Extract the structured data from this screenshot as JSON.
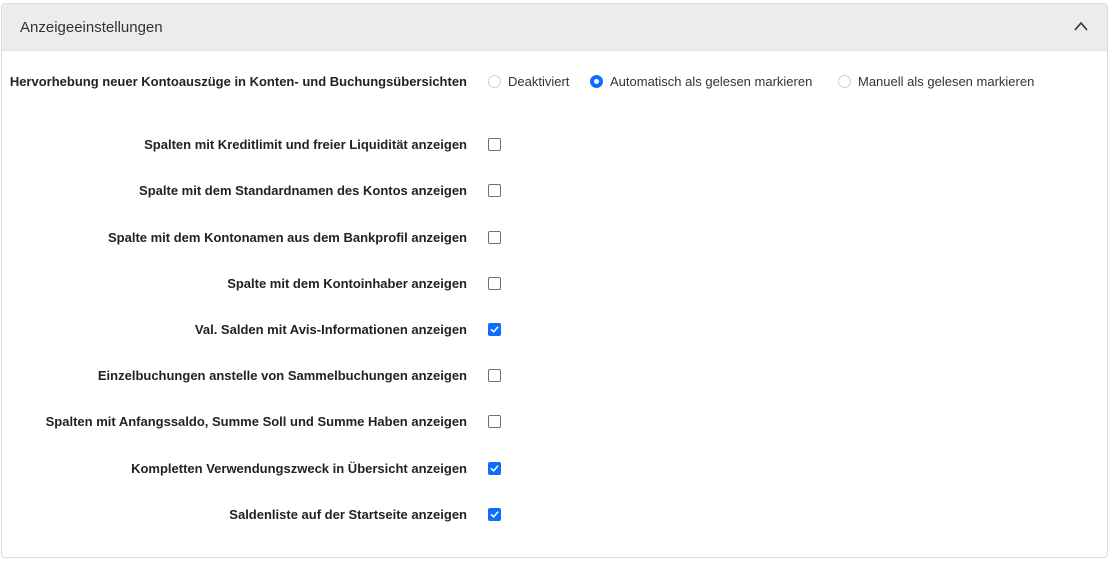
{
  "panel": {
    "title": "Anzeigeeinstellungen",
    "collapse_icon": "chevron-up-icon"
  },
  "highlight": {
    "label": "Hervorhebung neuer Kontoauszüge in Konten- und Buchungsübersichten",
    "options": [
      {
        "label": "Deaktiviert",
        "selected": false
      },
      {
        "label": "Automatisch als gelesen markieren",
        "selected": true
      },
      {
        "label": "Manuell als gelesen markieren",
        "selected": false
      }
    ]
  },
  "settings": [
    {
      "label": "Spalten mit Kreditlimit und freier Liquidität anzeigen",
      "checked": false
    },
    {
      "label": "Spalte mit dem Standardnamen des Kontos anzeigen",
      "checked": false
    },
    {
      "label": "Spalte mit dem Kontonamen aus dem Bankprofil anzeigen",
      "checked": false
    },
    {
      "label": "Spalte mit dem Kontoinhaber anzeigen",
      "checked": false
    },
    {
      "label": "Val. Salden mit Avis-Informationen anzeigen",
      "checked": true
    },
    {
      "label": "Einzelbuchungen anstelle von Sammelbuchungen anzeigen",
      "checked": false
    },
    {
      "label": "Spalten mit Anfangssaldo, Summe Soll und Summe Haben anzeigen",
      "checked": false
    },
    {
      "label": "Kompletten Verwendungszweck in Übersicht anzeigen",
      "checked": true
    },
    {
      "label": "Saldenliste auf der Startseite anzeigen",
      "checked": true
    }
  ],
  "colors": {
    "accent": "#0d6efd",
    "header_bg": "#ececec"
  }
}
